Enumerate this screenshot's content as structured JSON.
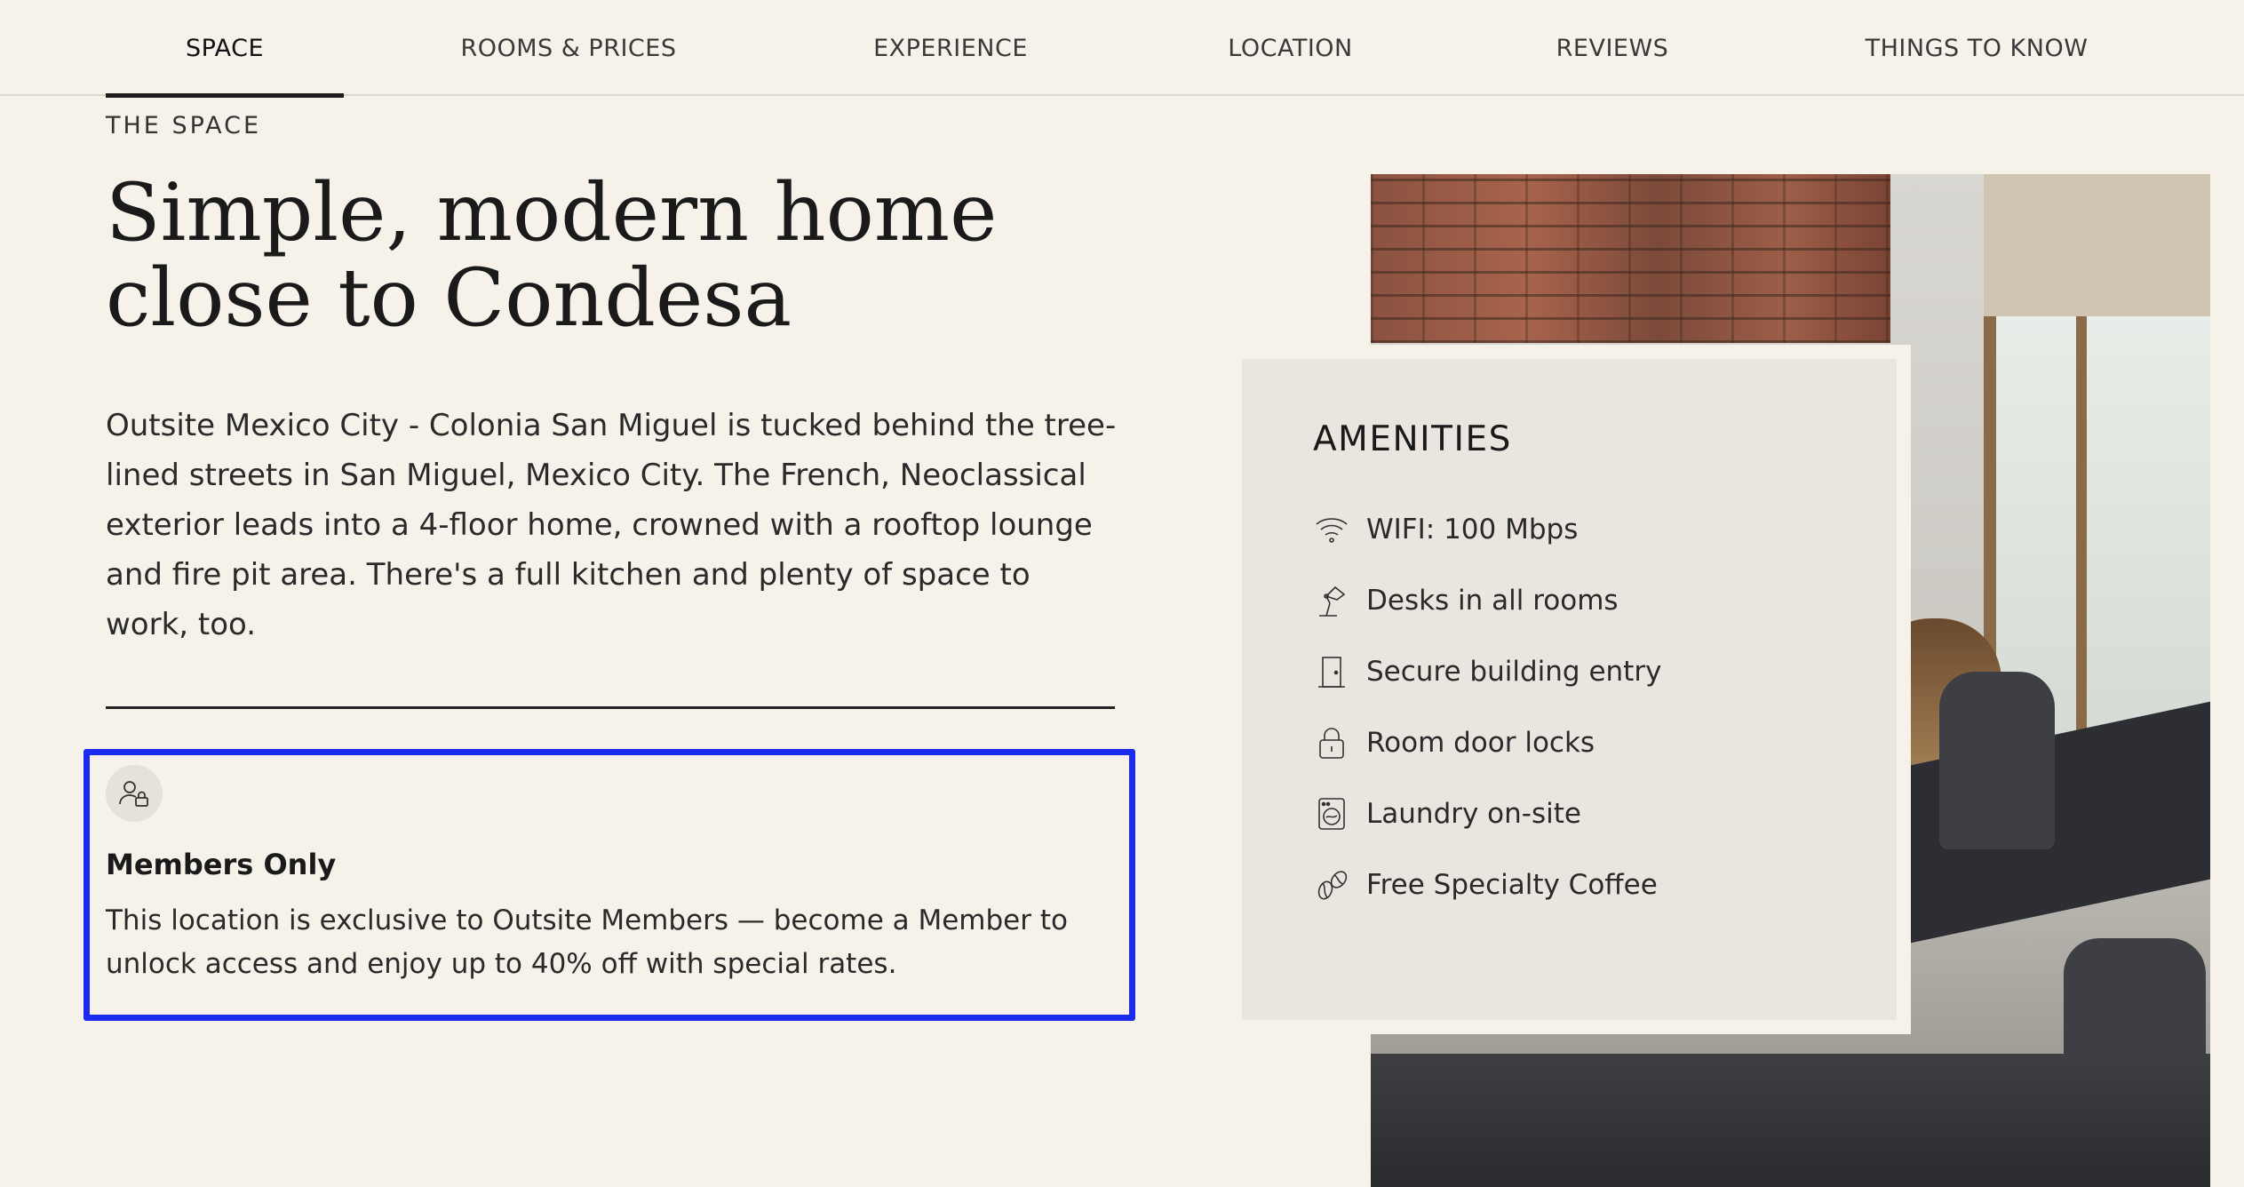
{
  "nav": {
    "tabs": [
      {
        "label": "SPACE",
        "active": true
      },
      {
        "label": "ROOMS & PRICES",
        "active": false
      },
      {
        "label": "EXPERIENCE",
        "active": false
      },
      {
        "label": "LOCATION",
        "active": false
      },
      {
        "label": "REVIEWS",
        "active": false
      },
      {
        "label": "THINGS TO KNOW",
        "active": false
      }
    ]
  },
  "space": {
    "eyebrow": "THE SPACE",
    "headline_line1": "Simple, modern home",
    "headline_line2": "close to Condesa",
    "description": "Outsite Mexico City - Colonia San Miguel is tucked behind the tree-lined streets in San Miguel, Mexico City. The French, Neoclassical exterior leads into a 4-floor home, crowned with a rooftop lounge and fire pit area. There's a full kitchen and plenty of space to work, too."
  },
  "members": {
    "icon": "members-lock-icon",
    "title": "Members Only",
    "text": "This location is exclusive to Outsite Members — become a Member to unlock access and enjoy up to 40% off with special rates."
  },
  "amenities": {
    "title": "AMENITIES",
    "items": [
      {
        "icon": "wifi-icon",
        "label": "WIFI: 100 Mbps"
      },
      {
        "icon": "desk-lamp-icon",
        "label": "Desks in all rooms"
      },
      {
        "icon": "door-icon",
        "label": "Secure building entry"
      },
      {
        "icon": "padlock-icon",
        "label": "Room door locks"
      },
      {
        "icon": "washing-machine-icon",
        "label": "Laundry on-site"
      },
      {
        "icon": "coffee-beans-icon",
        "label": "Free Specialty Coffee"
      }
    ]
  },
  "colors": {
    "background": "#f6f2ea",
    "card": "#eae5de",
    "highlight_box": "#1b2cf0"
  }
}
